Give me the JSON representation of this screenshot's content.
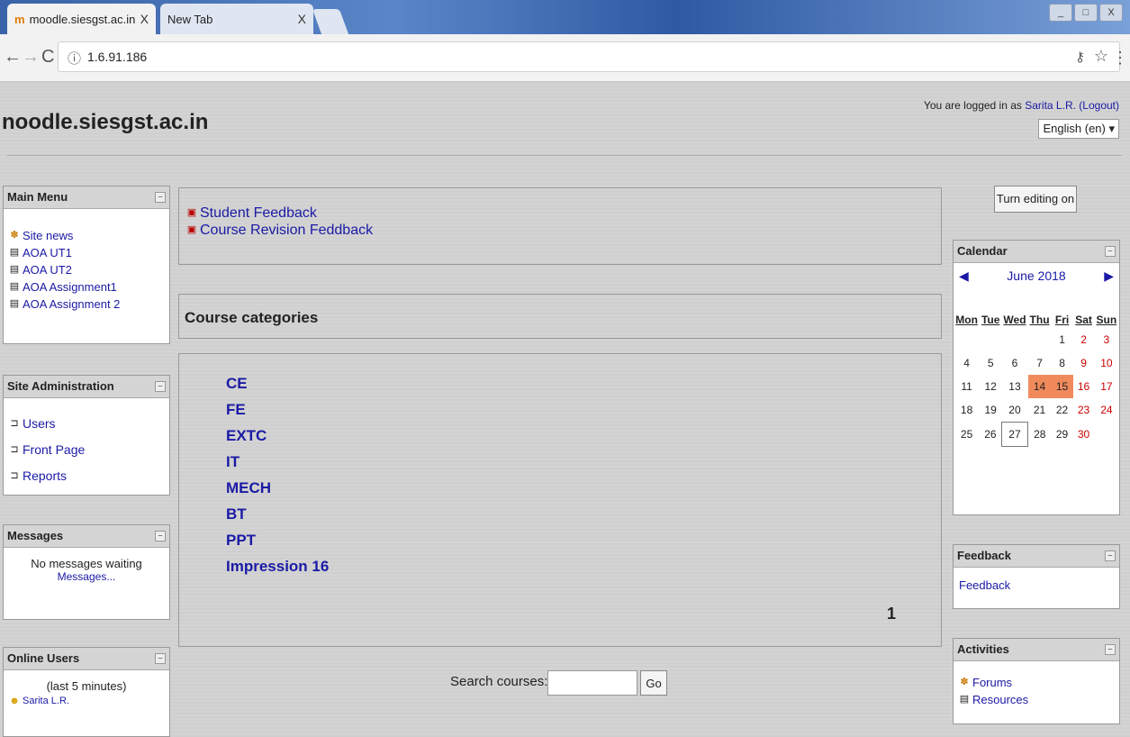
{
  "browser": {
    "tabs": [
      {
        "title": "moodle.siesgst.ac.in",
        "close": "X"
      },
      {
        "title": "New Tab",
        "close": "X"
      }
    ],
    "url": "1.6.91.186",
    "window_controls": [
      "_",
      "□",
      "X"
    ]
  },
  "header": {
    "site_name": "noodle.siesgst.ac.in",
    "logged_in_prefix": "You are logged in as",
    "user_name": "Sarita L.R.",
    "logout": "(Logout)",
    "language": "English (en) ▾"
  },
  "main_menu": {
    "title": "Main Menu",
    "items": [
      {
        "label": "Site news",
        "icon": "forum-icon"
      },
      {
        "label": "AOA UT1",
        "icon": "document-icon"
      },
      {
        "label": "AOA UT2",
        "icon": "document-icon"
      },
      {
        "label": "AOA Assignment1",
        "icon": "document-icon"
      },
      {
        "label": "AOA Assignment 2",
        "icon": "document-icon"
      }
    ]
  },
  "site_admin": {
    "title": "Site Administration",
    "items": [
      "Users",
      "Front Page",
      "Reports"
    ]
  },
  "messages": {
    "title": "Messages",
    "status": "No messages waiting",
    "link": "Messages..."
  },
  "online_users": {
    "title": "Online Users",
    "period": "(last 5 minutes)",
    "user": "Sarita L.R."
  },
  "feedback_links": [
    "Student Feedback",
    "Course Revision Feddback"
  ],
  "course_categories": {
    "title": "Course categories",
    "items": [
      "CE",
      "FE",
      "EXTC",
      "IT",
      "MECH",
      "BT",
      "PPT",
      "Impression 16"
    ],
    "last_count": "1"
  },
  "search": {
    "label": "Search courses:",
    "button": "Go",
    "value": ""
  },
  "editing_button": "Turn editing on",
  "calendar": {
    "title": "Calendar",
    "month": "June 2018",
    "weekdays": [
      "Mon",
      "Tue",
      "Wed",
      "Thu",
      "Fri",
      "Sat",
      "Sun"
    ],
    "weeks": [
      [
        "",
        "",
        "",
        "",
        "1",
        "2",
        "3"
      ],
      [
        "4",
        "5",
        "6",
        "7",
        "8",
        "9",
        "10"
      ],
      [
        "11",
        "12",
        "13",
        "14",
        "15",
        "16",
        "17"
      ],
      [
        "18",
        "19",
        "20",
        "21",
        "22",
        "23",
        "24"
      ],
      [
        "25",
        "26",
        "27",
        "28",
        "29",
        "30",
        ""
      ]
    ],
    "event_days": [
      "14",
      "15"
    ],
    "today": "27",
    "weekend_color": "#cc0000",
    "event_color": "#f08a5d"
  },
  "feedback_block": {
    "title": "Feedback",
    "link": "Feedback"
  },
  "activities": {
    "title": "Activities",
    "items": [
      {
        "label": "Forums",
        "icon": "forum-icon"
      },
      {
        "label": "Resources",
        "icon": "resource-icon"
      }
    ]
  }
}
